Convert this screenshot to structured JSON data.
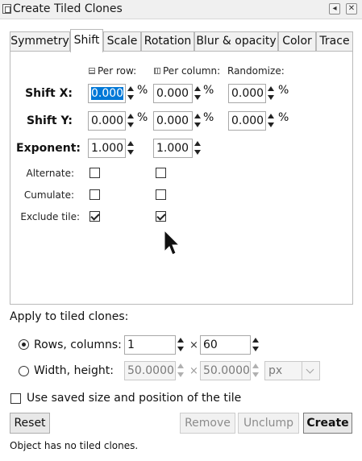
{
  "window": {
    "title": "Create Tiled Clones",
    "restore_glyph": "◂",
    "close_glyph": "✕"
  },
  "tabs": [
    {
      "label": "Symmetry",
      "active": false
    },
    {
      "label": "Shift",
      "active": true
    },
    {
      "label": "Scale",
      "active": false
    },
    {
      "label": "Rotation",
      "active": false
    },
    {
      "label": "Blur & opacity",
      "active": false
    },
    {
      "label": "Color",
      "active": false
    },
    {
      "label": "Trace",
      "active": false
    }
  ],
  "columns": {
    "per_row": "Per row:",
    "per_column": "Per column:",
    "randomize": "Randomize:"
  },
  "rows": {
    "shift_x": {
      "label": "Shift X:",
      "per_row": "0.000",
      "per_column": "0.000",
      "randomize": "0.000",
      "unit": "%"
    },
    "shift_y": {
      "label": "Shift Y:",
      "per_row": "0.000",
      "per_column": "0.000",
      "randomize": "0.000",
      "unit": "%"
    },
    "exponent": {
      "label": "Exponent:",
      "per_row": "1.000",
      "per_column": "1.000"
    }
  },
  "options": {
    "alternate": {
      "label": "Alternate:",
      "per_row": false,
      "per_column": false
    },
    "cumulate": {
      "label": "Cumulate:",
      "per_row": false,
      "per_column": false
    },
    "exclude_tile": {
      "label": "Exclude tile:",
      "per_row": true,
      "per_column": true
    }
  },
  "apply": {
    "heading": "Apply to tiled clones:",
    "rows_columns": {
      "label": "Rows, columns:",
      "selected": true,
      "rows": "1",
      "columns": "60"
    },
    "width_height": {
      "label": "Width, height:",
      "selected": false,
      "width": "50.0000",
      "height": "50.0000",
      "unit": "px"
    },
    "times": "×"
  },
  "use_saved": {
    "label": "Use saved size and position of the tile",
    "checked": false
  },
  "buttons": {
    "reset": "Reset",
    "remove": "Remove",
    "unclump": "Unclump",
    "create": "Create"
  },
  "status": "Object has no tiled clones."
}
